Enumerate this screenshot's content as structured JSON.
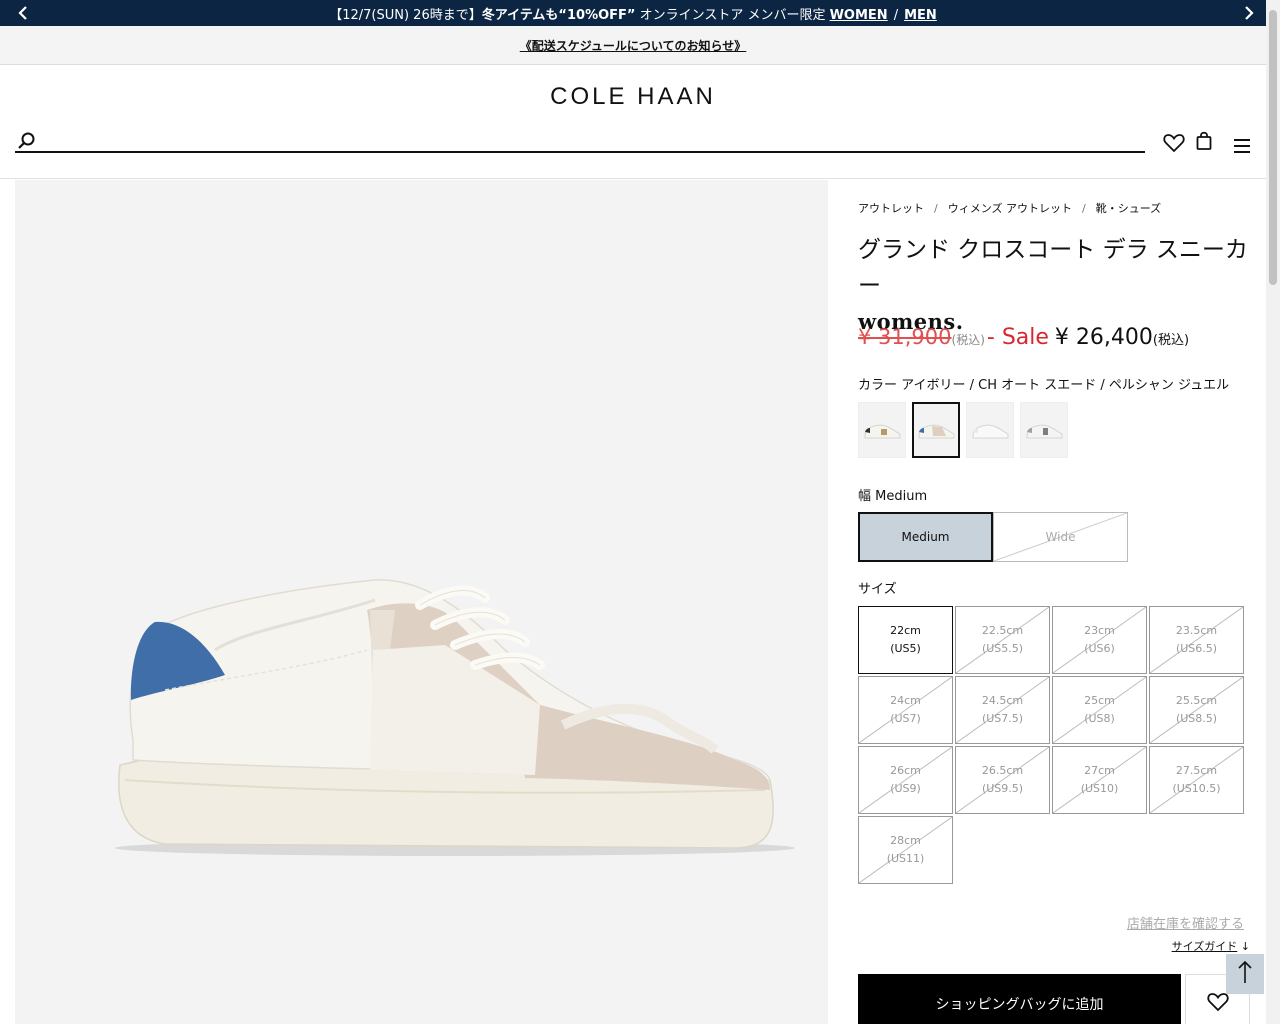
{
  "announcement": {
    "text_prefix": "【12/7(SUN) 26時まで】",
    "text_bold": "冬アイテムも“10%OFF”",
    "text_suffix": " オンラインストア メンバー限定 ",
    "link_women": "WOMEN",
    "separator": "/",
    "link_men": "MEN",
    "prev_icon": "chevron-left-icon",
    "next_icon": "chevron-right-icon"
  },
  "notice": {
    "link": "《配送スケジュールについてのお知らせ》"
  },
  "header": {
    "logo": "COLE HAAN",
    "search": {
      "placeholder": "",
      "value": ""
    },
    "icons": [
      "search-icon",
      "heart-icon",
      "shopping-bag-icon",
      "hamburger-menu-icon"
    ]
  },
  "breadcrumb": {
    "items": [
      "アウトレット",
      "ウィメンズ アウトレット",
      "靴・シューズ"
    ],
    "separator": "/"
  },
  "product": {
    "name": "グランド クロスコート デラ スニーカー",
    "gender": "womens.",
    "price": {
      "original": "¥ 31,900",
      "original_tax": "(税込)",
      "sale_label": "- Sale",
      "current": "¥ 26,400",
      "current_tax": "(税込)"
    },
    "color": {
      "label": "カラー アイボリー / CH オート スエード / ペルシャン ジュエル",
      "selected_index": 1,
      "swatch_count": 4
    },
    "width": {
      "label": "幅 Medium",
      "options": [
        {
          "label": "Medium",
          "selected": true,
          "available": true
        },
        {
          "label": "Wide",
          "selected": false,
          "available": false
        }
      ]
    },
    "size": {
      "label": "サイズ",
      "options": [
        {
          "cm": "22cm",
          "us": "(US5)",
          "available": true
        },
        {
          "cm": "22.5cm",
          "us": "(US5.5)",
          "available": false
        },
        {
          "cm": "23cm",
          "us": "(US6)",
          "available": false
        },
        {
          "cm": "23.5cm",
          "us": "(US6.5)",
          "available": false
        },
        {
          "cm": "24cm",
          "us": "(US7)",
          "available": false
        },
        {
          "cm": "24.5cm",
          "us": "(US7.5)",
          "available": false
        },
        {
          "cm": "25cm",
          "us": "(US8)",
          "available": false
        },
        {
          "cm": "25.5cm",
          "us": "(US8.5)",
          "available": false
        },
        {
          "cm": "26cm",
          "us": "(US9)",
          "available": false
        },
        {
          "cm": "26.5cm",
          "us": "(US9.5)",
          "available": false
        },
        {
          "cm": "27cm",
          "us": "(US10)",
          "available": false
        },
        {
          "cm": "27.5cm",
          "us": "(US10.5)",
          "available": false
        },
        {
          "cm": "28cm",
          "us": "(US11)",
          "available": false
        }
      ]
    },
    "store_stock_link": "店舗在庫を確認する",
    "size_guide_link": "サイズガイド",
    "size_guide_arrow": "↓",
    "add_to_bag": "ショッピングバッグに追加"
  },
  "colors": {
    "topbar_bg": "#0c2543",
    "sale_red": "#d7262e",
    "selected_width_bg": "#c7d2da",
    "accent_blue": "#3f6ea8"
  }
}
